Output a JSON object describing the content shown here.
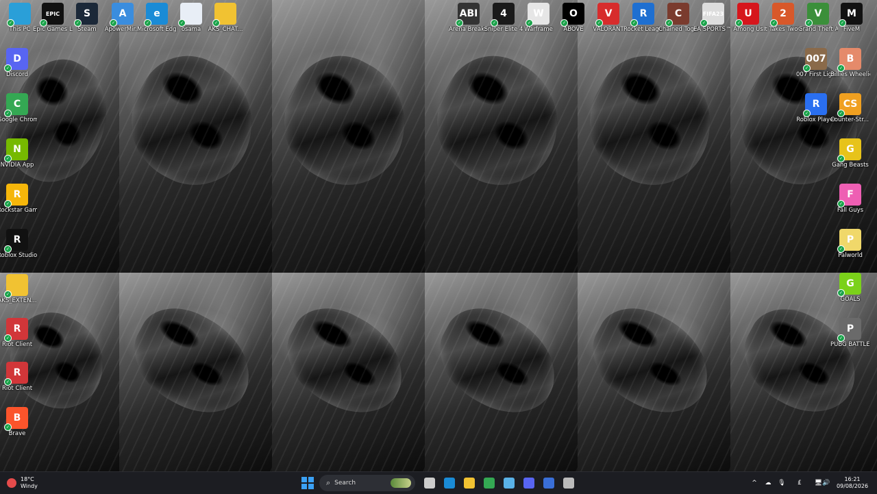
{
  "colors": {
    "taskbar_bg": "#1c1d22",
    "accent": "#3ba1f5"
  },
  "desktop_icons": [
    {
      "label": "This PC",
      "icon": "monitor-icon",
      "color": "#2a9fd8",
      "glyph": ""
    },
    {
      "label": "Epic Games Launcher",
      "icon": "epic-games-icon",
      "color": "#111111",
      "glyph": "EPIC"
    },
    {
      "label": "Steam",
      "icon": "steam-icon",
      "color": "#1b2838",
      "glyph": "S"
    },
    {
      "label": "ApowerMir...",
      "icon": "apowermirror-icon",
      "color": "#3a8dde",
      "glyph": "A"
    },
    {
      "label": "Microsoft Edge",
      "icon": "edge-icon",
      "color": "#1a8bd6",
      "glyph": "e"
    },
    {
      "label": "osama",
      "icon": "document-icon",
      "color": "#e8eef6",
      "glyph": ""
    },
    {
      "label": "AKS_CHAT...",
      "icon": "folder-icon",
      "color": "#f1c232",
      "glyph": ""
    },
    {
      "label": "Arena Breako...",
      "icon": "arena-breakout-icon",
      "color": "#333333",
      "glyph": "ABI"
    },
    {
      "label": "Sniper Elite 4",
      "icon": "sniper-elite-icon",
      "color": "#1a1a1a",
      "glyph": "4"
    },
    {
      "label": "Warframe",
      "icon": "warframe-icon",
      "color": "#e6e6e6",
      "glyph": "W"
    },
    {
      "label": "ABOVE",
      "icon": "above-icon",
      "color": "#000000",
      "glyph": "O"
    },
    {
      "label": "VALORANT",
      "icon": "valorant-icon",
      "color": "#d72c2c",
      "glyph": "V"
    },
    {
      "label": "Rocket League®",
      "icon": "rocket-league-icon",
      "color": "#1e6fd1",
      "glyph": "R"
    },
    {
      "label": "Chained Together",
      "icon": "chained-together-icon",
      "color": "#7a3b2e",
      "glyph": "C"
    },
    {
      "label": "EA SPORTS™ FIFA 23",
      "icon": "fifa-icon",
      "color": "#dddddd",
      "glyph": "FIFA23"
    },
    {
      "label": "Among Us",
      "icon": "among-us-icon",
      "color": "#d6161c",
      "glyph": "U"
    },
    {
      "label": "It Takes Two Friend's Pass",
      "icon": "it-takes-two-icon",
      "color": "#d8582a",
      "glyph": "2"
    },
    {
      "label": "Grand Theft Auto V Le...",
      "icon": "gta-icon",
      "color": "#3b8f3a",
      "glyph": "V"
    },
    {
      "label": "FiveM",
      "icon": "fivem-icon",
      "color": "#111111",
      "glyph": "M"
    },
    {
      "label": "Discord",
      "icon": "discord-icon",
      "color": "#5865f2",
      "glyph": "D"
    },
    {
      "label": "Google Chrome",
      "icon": "chrome-icon",
      "color": "#34a853",
      "glyph": "C"
    },
    {
      "label": "NVIDIA App",
      "icon": "nvidia-icon",
      "color": "#76b900",
      "glyph": "N"
    },
    {
      "label": "Rockstar Games ...",
      "icon": "rockstar-icon",
      "color": "#f5b60a",
      "glyph": "R"
    },
    {
      "label": "Roblox Studio",
      "icon": "roblox-studio-icon",
      "color": "#111111",
      "glyph": "R"
    },
    {
      "label": "AKS_EXTEN...",
      "icon": "folder-icon",
      "color": "#f1c232",
      "glyph": ""
    },
    {
      "label": "Riot Client",
      "icon": "riot-client-icon",
      "color": "#d13639",
      "glyph": "R"
    },
    {
      "label": "Riot Client",
      "icon": "riot-client-icon",
      "color": "#d13639",
      "glyph": "R"
    },
    {
      "label": "Brave",
      "icon": "brave-icon",
      "color": "#fb542b",
      "glyph": "B"
    },
    {
      "label": "007 First Light",
      "icon": "007-first-light-icon",
      "color": "#8a6a4a",
      "glyph": "007"
    },
    {
      "label": "Billies Wheelie",
      "icon": "billies-wheelie-icon",
      "color": "#e58a6a",
      "glyph": "B"
    },
    {
      "label": "Roblox Player",
      "icon": "roblox-player-icon",
      "color": "#2a6ff0",
      "glyph": "R"
    },
    {
      "label": "Counter-Str... 2",
      "icon": "counter-strike-icon",
      "color": "#f0a020",
      "glyph": "CS"
    },
    {
      "label": "Gang Beasts",
      "icon": "gang-beasts-icon",
      "color": "#e7c31a",
      "glyph": "G"
    },
    {
      "label": "Fall Guys",
      "icon": "fall-guys-icon",
      "color": "#ee5fb3",
      "glyph": "F"
    },
    {
      "label": "Palworld",
      "icon": "palworld-icon",
      "color": "#f0d86a",
      "glyph": "P"
    },
    {
      "label": "GOALS",
      "icon": "goals-icon",
      "color": "#7bd11a",
      "glyph": "G"
    },
    {
      "label": "PUBG BATTLEGR...",
      "icon": "pubg-icon",
      "color": "#6a6a6a",
      "glyph": "P"
    }
  ],
  "taskbar": {
    "weather": {
      "temp": "18°C",
      "condition": "Windy"
    },
    "search_placeholder": "Search",
    "apps": [
      {
        "name": "task-view-icon",
        "color": "#cccccc"
      },
      {
        "name": "edge-icon",
        "color": "#1a8bd6"
      },
      {
        "name": "file-explorer-icon",
        "color": "#f1c232"
      },
      {
        "name": "chrome-icon",
        "color": "#34a853"
      },
      {
        "name": "notepad-icon",
        "color": "#5ab2e8"
      },
      {
        "name": "discord-icon",
        "color": "#5865f2"
      },
      {
        "name": "app-icon",
        "color": "#3a6fd8"
      },
      {
        "name": "settings-icon",
        "color": "#bbbbbb"
      }
    ],
    "tray": {
      "chevron": "^",
      "keyboard": "£"
    },
    "time": "16:21",
    "date": "09/08/2026"
  }
}
